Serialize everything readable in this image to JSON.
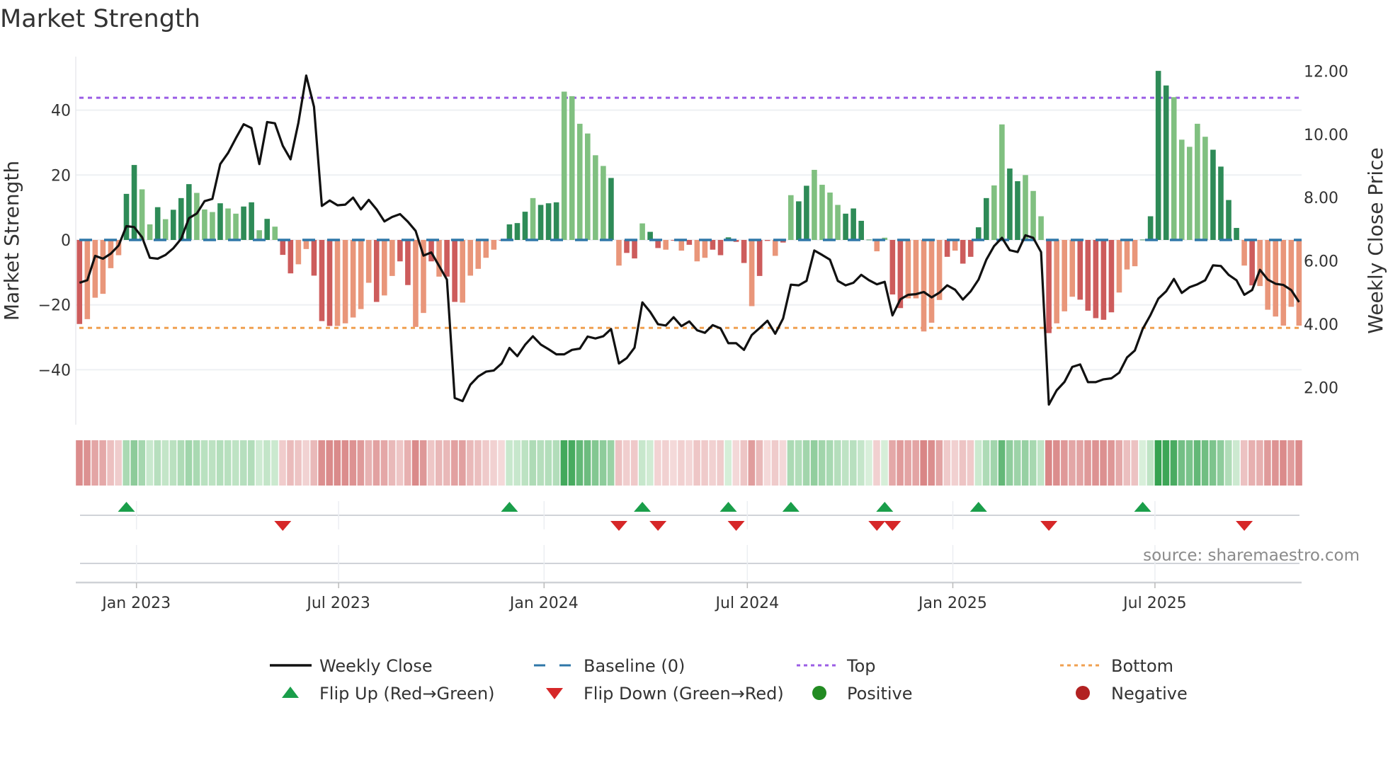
{
  "chart_data": {
    "type": "bar",
    "title": "Market Strength",
    "ylabel": "Market Strength",
    "ylabel_right": "Weekly Close Price",
    "source": "source: sharemaestro.com",
    "ylim": [
      -57,
      56.5
    ],
    "ylim_right": [
      0.83,
      12.46
    ],
    "start_date": "2022-11-11",
    "frequency": "weekly",
    "top_level": 43.8,
    "bottom_level": -27.1,
    "y_ticks": [
      {
        "v": -40,
        "label": "−40"
      },
      {
        "v": -20,
        "label": "−20"
      },
      {
        "v": 0,
        "label": "0"
      },
      {
        "v": 20,
        "label": "20"
      },
      {
        "v": 40,
        "label": "40"
      }
    ],
    "y_ticks_right": [
      {
        "v": 2,
        "label": "2.00"
      },
      {
        "v": 4,
        "label": "4.00"
      },
      {
        "v": 6,
        "label": "6.00"
      },
      {
        "v": 8,
        "label": "8.00"
      },
      {
        "v": 10,
        "label": "10.00"
      },
      {
        "v": 12,
        "label": "12.00"
      }
    ],
    "x_ticks": [
      {
        "date": "2023-01-01",
        "label": "Jan 2023"
      },
      {
        "date": "2023-07-01",
        "label": "Jul 2023"
      },
      {
        "date": "2024-01-01",
        "label": "Jan 2024"
      },
      {
        "date": "2024-07-01",
        "label": "Jul 2024"
      },
      {
        "date": "2025-01-01",
        "label": "Jan 2025"
      },
      {
        "date": "2025-07-01",
        "label": "Jul 2025"
      }
    ],
    "strength": [
      -25.9,
      -24.4,
      -17.8,
      -16.6,
      -8.7,
      -4.7,
      14.2,
      23.1,
      15.6,
      4.8,
      10.1,
      6.4,
      9.3,
      12.9,
      17.2,
      14.5,
      9.4,
      8.6,
      11.3,
      9.7,
      8.1,
      10.3,
      11.6,
      3.0,
      6.5,
      4.1,
      -4.6,
      -10.3,
      -7.5,
      -2.8,
      -11.0,
      -25.0,
      -26.5,
      -26.5,
      -25.7,
      -23.9,
      -21.3,
      -13.2,
      -19.1,
      -17.1,
      -11.1,
      -6.6,
      -13.9,
      -26.8,
      -22.5,
      -6.6,
      -11.3,
      -11.3,
      -19.1,
      -19.3,
      -11.0,
      -8.9,
      -5.5,
      -3.0,
      -0.2,
      4.8,
      5.2,
      8.7,
      12.9,
      10.8,
      11.3,
      11.6,
      45.7,
      44.3,
      35.8,
      32.8,
      26.1,
      22.8,
      19.1,
      -7.9,
      -4.0,
      -5.7,
      5.1,
      2.5,
      -2.5,
      -3.0,
      -0.2,
      -3.3,
      -1.5,
      -6.6,
      -5.5,
      -3.0,
      -4.7,
      0.8,
      -0.6,
      -7.1,
      -20.4,
      -11.1,
      -0.3,
      -4.9,
      -0.8,
      13.8,
      11.9,
      16.7,
      21.6,
      17.0,
      14.6,
      10.8,
      8.1,
      9.7,
      5.9,
      0.1,
      -3.5,
      0.7,
      -16.8,
      -21.0,
      -18.0,
      -18.0,
      -28.2,
      -25.5,
      -18.5,
      -5.2,
      -3.3,
      -7.3,
      -5.2,
      3.9,
      12.9,
      16.8,
      35.6,
      22.0,
      18.1,
      20.0,
      15.1,
      7.3,
      -28.7,
      -25.7,
      -22.0,
      -17.5,
      -18.4,
      -21.8,
      -24.1,
      -24.6,
      -22.3,
      -16.2,
      -9.1,
      -8.1,
      0.1,
      7.3,
      52.1,
      47.6,
      44.0,
      30.9,
      28.7,
      35.8,
      31.8,
      27.8,
      22.6,
      12.3,
      3.7,
      -7.9,
      -14.0,
      -14.2,
      -21.5,
      -23.6,
      -26.4,
      -20.6,
      -26.4
    ],
    "shade": "dllllldd lld lddd llldlld dldldd lldddlllll dl l ddlldlddlllll ddddlddd llllll dlddldd ldld l ldddddldd ldlddllll ddddllddllllldldddd llddll ldllldddddlllddd dlllllddddldl",
    "close": [
      5.31,
      5.39,
      6.16,
      6.07,
      6.23,
      6.49,
      7.1,
      7.07,
      6.75,
      6.1,
      6.07,
      6.19,
      6.4,
      6.7,
      7.35,
      7.5,
      7.89,
      7.96,
      9.06,
      9.41,
      9.88,
      10.32,
      10.2,
      9.06,
      10.39,
      10.35,
      9.64,
      9.21,
      10.37,
      11.86,
      10.87,
      7.74,
      7.91,
      7.76,
      7.78,
      8.0,
      7.63,
      7.93,
      7.63,
      7.25,
      7.39,
      7.48,
      7.24,
      6.95,
      6.17,
      6.27,
      5.84,
      5.41,
      1.67,
      1.57,
      2.09,
      2.35,
      2.5,
      2.54,
      2.76,
      3.25,
      2.99,
      3.35,
      3.62,
      3.36,
      3.21,
      3.05,
      3.05,
      3.19,
      3.23,
      3.61,
      3.55,
      3.62,
      3.85,
      2.76,
      2.93,
      3.26,
      4.69,
      4.39,
      4.0,
      3.96,
      4.22,
      3.94,
      4.09,
      3.81,
      3.73,
      3.97,
      3.87,
      3.4,
      3.4,
      3.19,
      3.66,
      3.88,
      4.11,
      3.7,
      4.18,
      5.25,
      5.23,
      5.37,
      6.33,
      6.19,
      6.04,
      5.37,
      5.23,
      5.31,
      5.56,
      5.39,
      5.26,
      5.34,
      4.28,
      4.79,
      4.93,
      4.95,
      5.02,
      4.85,
      5.0,
      5.23,
      5.09,
      4.78,
      5.04,
      5.41,
      6.04,
      6.47,
      6.73,
      6.34,
      6.28,
      6.81,
      6.73,
      6.28,
      1.46,
      1.91,
      2.18,
      2.65,
      2.73,
      2.17,
      2.17,
      2.26,
      2.29,
      2.47,
      2.95,
      3.17,
      3.85,
      4.29,
      4.81,
      5.04,
      5.43,
      4.99,
      5.17,
      5.26,
      5.39,
      5.86,
      5.84,
      5.56,
      5.39,
      4.93,
      5.08,
      5.72,
      5.41,
      5.28,
      5.24,
      5.08,
      4.7
    ],
    "flip_up_weeks": [
      6,
      55,
      72,
      83,
      91,
      103,
      115,
      136
    ],
    "flip_down_weeks": [
      26,
      69,
      74,
      84,
      102,
      104,
      124,
      149
    ],
    "colors": {
      "pos_dark": "#2e8b57",
      "pos_light": "#80c080",
      "neg_dark": "#cd5c5c",
      "neg_light": "#e9967a",
      "close": "#111111",
      "baseline": "#2f77a8",
      "top": "#9b5de5",
      "bottom": "#f0a050",
      "flip_up": "#1a9e4a",
      "flip_down": "#d62728",
      "positive": "#228b22",
      "negative": "#b22222"
    },
    "legend": [
      {
        "label": "Weekly Close",
        "kind": "line"
      },
      {
        "label": "Baseline (0)",
        "kind": "dash"
      },
      {
        "label": "Top",
        "kind": "dot-top"
      },
      {
        "label": "Bottom",
        "kind": "dot-bottom"
      },
      {
        "label": "Flip Up (Red→Green)",
        "kind": "tri-up"
      },
      {
        "label": "Flip Down (Green→Red)",
        "kind": "tri-down"
      },
      {
        "label": "Positive",
        "kind": "circle-pos"
      },
      {
        "label": "Negative",
        "kind": "circle-neg"
      }
    ]
  }
}
